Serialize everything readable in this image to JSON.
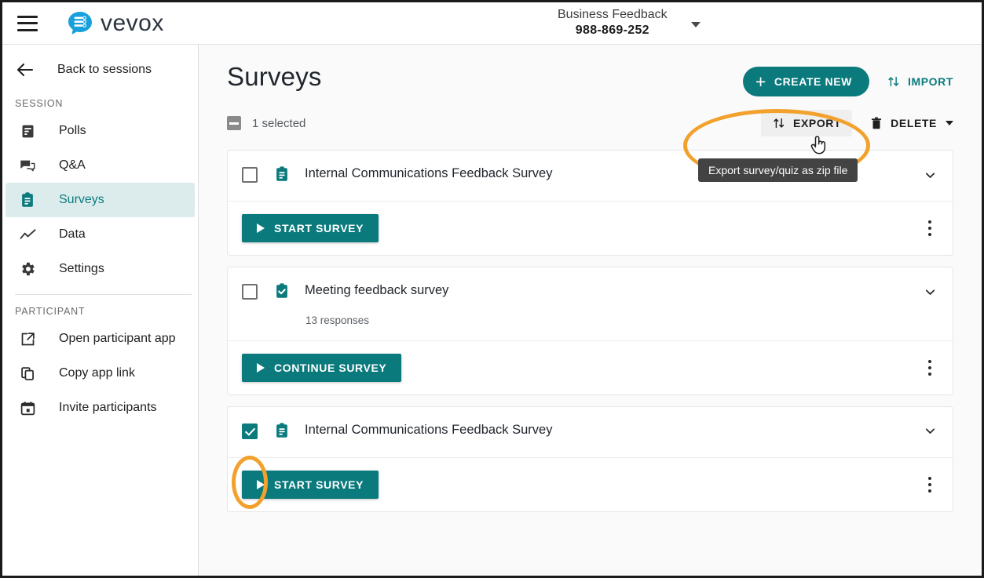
{
  "topbar": {
    "menu_icon": "hamburger-icon",
    "brand_name": "vevox",
    "brand_logo_icon": "vevox-speech-bubble-logo",
    "session_title": "Business Feedback",
    "session_code": "988-869-252",
    "session_caret_icon": "chevron-down-icon"
  },
  "sidebar": {
    "back": {
      "label": "Back to sessions",
      "icon": "arrow-left-icon"
    },
    "groups": [
      {
        "label": "SESSION",
        "items": [
          {
            "label": "Polls",
            "icon": "polls-icon",
            "active": false
          },
          {
            "label": "Q&A",
            "icon": "qa-chat-icon",
            "active": false
          },
          {
            "label": "Surveys",
            "icon": "clipboard-icon",
            "active": true
          },
          {
            "label": "Data",
            "icon": "trend-line-icon",
            "active": false
          },
          {
            "label": "Settings",
            "icon": "gear-icon",
            "active": false
          }
        ]
      },
      {
        "label": "PARTICIPANT",
        "items": [
          {
            "label": "Open participant app",
            "icon": "external-link-icon",
            "active": false
          },
          {
            "label": "Copy app link",
            "icon": "copy-icon",
            "active": false
          },
          {
            "label": "Invite participants",
            "icon": "calendar-icon",
            "active": false
          }
        ]
      }
    ]
  },
  "main": {
    "page_title": "Surveys",
    "create_new_label": "CREATE NEW",
    "create_new_icon": "plus-icon",
    "import_label": "IMPORT",
    "import_icon": "import-arrows-icon",
    "toolbar": {
      "selected_label": "1 selected",
      "select_all_state": "indeterminate",
      "export_label": "EXPORT",
      "export_icon": "export-arrows-icon",
      "delete_label": "DELETE",
      "delete_icon": "trash-icon",
      "delete_caret_icon": "chevron-down-icon"
    },
    "cards": [
      {
        "title": "Internal Communications Feedback Survey",
        "icon": "clipboard-icon",
        "checked": false,
        "responses": "",
        "action_label": "START SURVEY",
        "action_icon": "play-icon",
        "chevron_icon": "chevron-down-icon",
        "kebab_icon": "more-vertical-icon"
      },
      {
        "title": "Meeting feedback survey",
        "icon": "clipboard-check-icon",
        "checked": false,
        "responses": "13 responses",
        "action_label": "CONTINUE SURVEY",
        "action_icon": "play-icon",
        "chevron_icon": "chevron-down-icon",
        "kebab_icon": "more-vertical-icon"
      },
      {
        "title": "Internal Communications Feedback Survey",
        "icon": "clipboard-icon",
        "checked": true,
        "responses": "",
        "action_label": "START SURVEY",
        "action_icon": "play-icon",
        "chevron_icon": "chevron-down-icon",
        "kebab_icon": "more-vertical-icon"
      }
    ]
  },
  "overlays": {
    "tooltip_text": "Export survey/quiz as zip file",
    "cursor_icon": "pointer-hand-cursor",
    "annotation_color": "#f2a22c",
    "annotations": [
      {
        "name": "export-highlight",
        "shape": "ellipse"
      },
      {
        "name": "checkbox-highlight",
        "shape": "ellipse"
      }
    ]
  },
  "colors": {
    "teal": "#0b7a7d",
    "teal_light": "#dcecec",
    "orange": "#f2a22c",
    "tooltip_bg": "#434343",
    "page_bg": "#fafafa"
  }
}
